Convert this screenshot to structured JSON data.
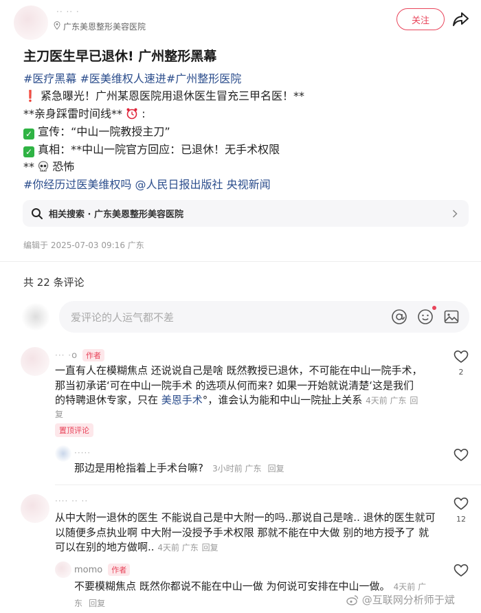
{
  "header": {
    "location": "广东美恩整形美容医院",
    "follow_label": "关注"
  },
  "post": {
    "title": "主刀医生早已退休! 广州整形黑幕",
    "tags_line": "#医疗黑幕 #医美维权人速进#广州整形医院",
    "line1": "紧急曝光！广州某恩医院用退休医生冒充三甲名医！**",
    "line2": "**亲身踩雷时间线**",
    "line3": "宣传：“中山一院教授主刀”",
    "line4": "真相：**中山一院官方回应：已退休！无手术权限",
    "line5": "**",
    "line5b": "恐怖",
    "tags_line2": "#你经历过医美维权吗 @人民日报出版社 央视新闻"
  },
  "related_search": {
    "label": "相关搜索 · 广东美恩整形美容医院"
  },
  "meta": {
    "edited": "编辑于 2025-07-03 09:16 广东"
  },
  "comments_header": {
    "count_label": "共 22 条评论"
  },
  "comment_input": {
    "placeholder": "爱评论的人运气都不差"
  },
  "comments": [
    {
      "name": "o",
      "badge": "作者",
      "line1": "一直有人在模糊焦点 还说说自己是啥 既然教授已退休，不可能在中山一院手术，",
      "line2": "那当初承诺‘可在中山一院手术 的选项从何而来? 如果一开始就说清楚‘这是我们",
      "line3a": "的特聘退休专家，只在 ",
      "line3b": "美恩手术",
      "line3c": "°，谁会认为能和中山一院扯上关系",
      "time": "4天前 广东",
      "reply_label": "回",
      "reply_label2": "复",
      "pin": "置顶评论",
      "likes": "2"
    },
    {
      "reply_text": "那边是用枪指着上手术台嘛?",
      "time": "3小时前 广东",
      "reply_label": "回复"
    },
    {
      "line1": "从中大附一退休的医生 不能说自己是中大附一的吗..那说自己是啥.. 退休的医生就可",
      "line2": "以随便多点执业啊 中大附一没授予手术权限 那就不能在中大做 别的地方授予了 就",
      "line3": "可以在别的地方做啊..",
      "time": "4天前 广东",
      "reply_label": "回复",
      "likes": "12"
    },
    {
      "name": "momo",
      "badge": "作者",
      "reply_text": "不要模糊焦点 既然你都说不能在中山一做 为何说可安排在中山一做。",
      "time": "4天前 广",
      "time2": "东",
      "reply_label": "回复"
    }
  ],
  "watermark": "@互联网分析师于斌",
  "icons": {
    "accent": "#e8445a",
    "tag_color": "#2b4d8c"
  }
}
